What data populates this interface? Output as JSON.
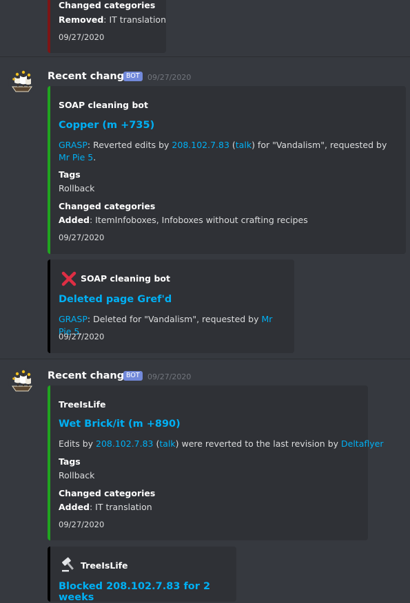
{
  "top_embed": {
    "field_name": "Changed categories",
    "field_bold": "Removed",
    "field_text": ": IT translation",
    "footer": "09/27/2020"
  },
  "message1": {
    "username": "Recent changes",
    "badge": "BOT",
    "timestamp": "09/27/2020",
    "embed1": {
      "author": "SOAP cleaning bot",
      "title": "Copper (m +735)",
      "desc_link1": "GRASP",
      "desc_t1": ": Reverted edits by ",
      "desc_link2": "208.102.7.83",
      "desc_t2": " (",
      "desc_link3": "talk",
      "desc_t3": ") for \"Vandalism\", requested by ",
      "desc_link4": "Mr Pie 5",
      "desc_t4": ".",
      "tags_name": "Tags",
      "tags_value": "Rollback",
      "cat_name": "Changed categories",
      "cat_bold": "Added",
      "cat_text": ": ItemInfoboxes, Infoboxes without crafting recipes",
      "footer": "09/27/2020"
    },
    "embed2": {
      "icon": "red-x-icon",
      "author": "SOAP cleaning bot",
      "title": "Deleted page Gref'd",
      "desc_link1": "GRASP",
      "desc_t1": ": Deleted for \"Vandalism\", requested by ",
      "desc_link2": "Mr Pie 5",
      "desc_t2": ".",
      "footer": "09/27/2020"
    }
  },
  "message2": {
    "username": "Recent changes",
    "badge": "BOT",
    "timestamp": "09/27/2020",
    "embed1": {
      "author": "TreeIsLife",
      "title": "Wet Brick/it (m +890)",
      "desc_t0": "Edits by ",
      "desc_link1": "208.102.7.83",
      "desc_t1": " (",
      "desc_link2": "talk",
      "desc_t2": ") were reverted to the last revision by ",
      "desc_link3": "Deltaflyer",
      "tags_name": "Tags",
      "tags_value": "Rollback",
      "cat_name": "Changed categories",
      "cat_bold": "Added",
      "cat_text": ": IT translation",
      "footer": "09/27/2020"
    },
    "embed2": {
      "icon": "gavel-icon",
      "author": "TreeIsLife",
      "title": "Blocked 208.102.7.83 for 2 weeks"
    }
  },
  "colors": {
    "background": "#36393f",
    "embed_bg": "#2f3136",
    "link": "#00b0f4",
    "bot_badge": "#7289da",
    "edit_border": "#20a520",
    "removed_border": "#7d1515",
    "admin_border": "#000000"
  }
}
